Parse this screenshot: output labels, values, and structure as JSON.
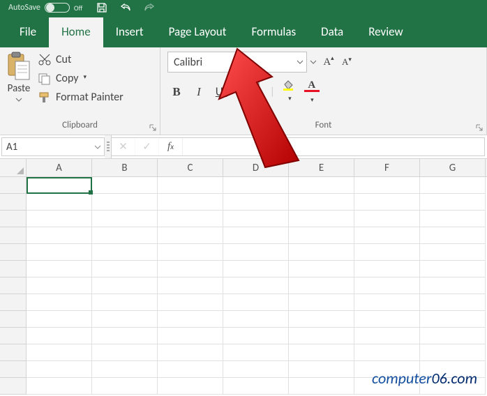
{
  "titlebar": {
    "autosave_label": "AutoSave",
    "autosave_state": "Off"
  },
  "tabs": [
    "File",
    "Home",
    "Insert",
    "Page Layout",
    "Formulas",
    "Data",
    "Review"
  ],
  "active_tab_index": 1,
  "ribbon": {
    "clipboard": {
      "paste": "Paste",
      "cut": "Cut",
      "copy": "Copy",
      "format_painter": "Format Painter",
      "group_label": "Clipboard"
    },
    "font": {
      "name": "Calibri",
      "group_label": "Font"
    }
  },
  "namebox": {
    "value": "A1"
  },
  "formula_bar": {
    "value": ""
  },
  "grid": {
    "columns": [
      "A",
      "B",
      "C",
      "D",
      "E",
      "F",
      "G"
    ],
    "row_count": 13,
    "active_cell": "A1"
  },
  "watermark": {
    "brand": "computer",
    "suffix": "06.com"
  }
}
